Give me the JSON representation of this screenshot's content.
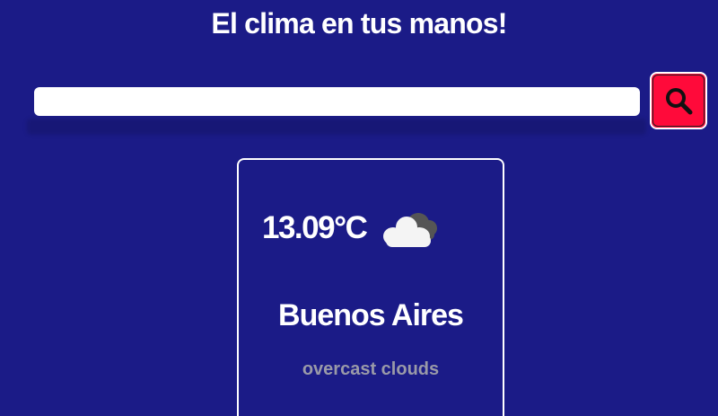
{
  "header": {
    "title": "El clima en tus manos!"
  },
  "search": {
    "value": "",
    "placeholder": "",
    "button_icon": "search-icon",
    "button_color": "#ff0a3a"
  },
  "weather": {
    "temperature": "13.09°C",
    "icon": "overcast-clouds-icon",
    "city": "Buenos Aires",
    "description": "overcast clouds"
  },
  "colors": {
    "background": "#1b1b87",
    "text": "#ffffff",
    "description": "#9a9aa8"
  }
}
